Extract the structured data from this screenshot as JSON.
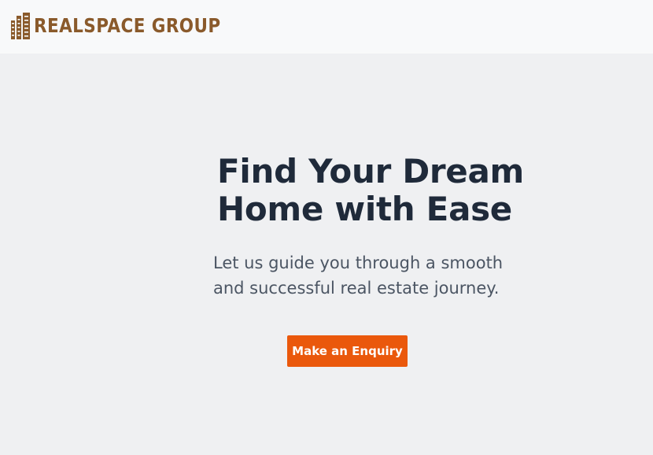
{
  "brand": {
    "name": "REALSPACE GROUP",
    "color": "#8a5a2b",
    "icon": "building-icon"
  },
  "hero": {
    "title_line1": "Find Your Dream",
    "title_line2": "Home with Ease",
    "subtitle_line1": "Let us guide you through a smooth",
    "subtitle_line2": "and successful real estate journey.",
    "cta_label": "Make an Enquiry",
    "cta_color": "#ea580c"
  }
}
